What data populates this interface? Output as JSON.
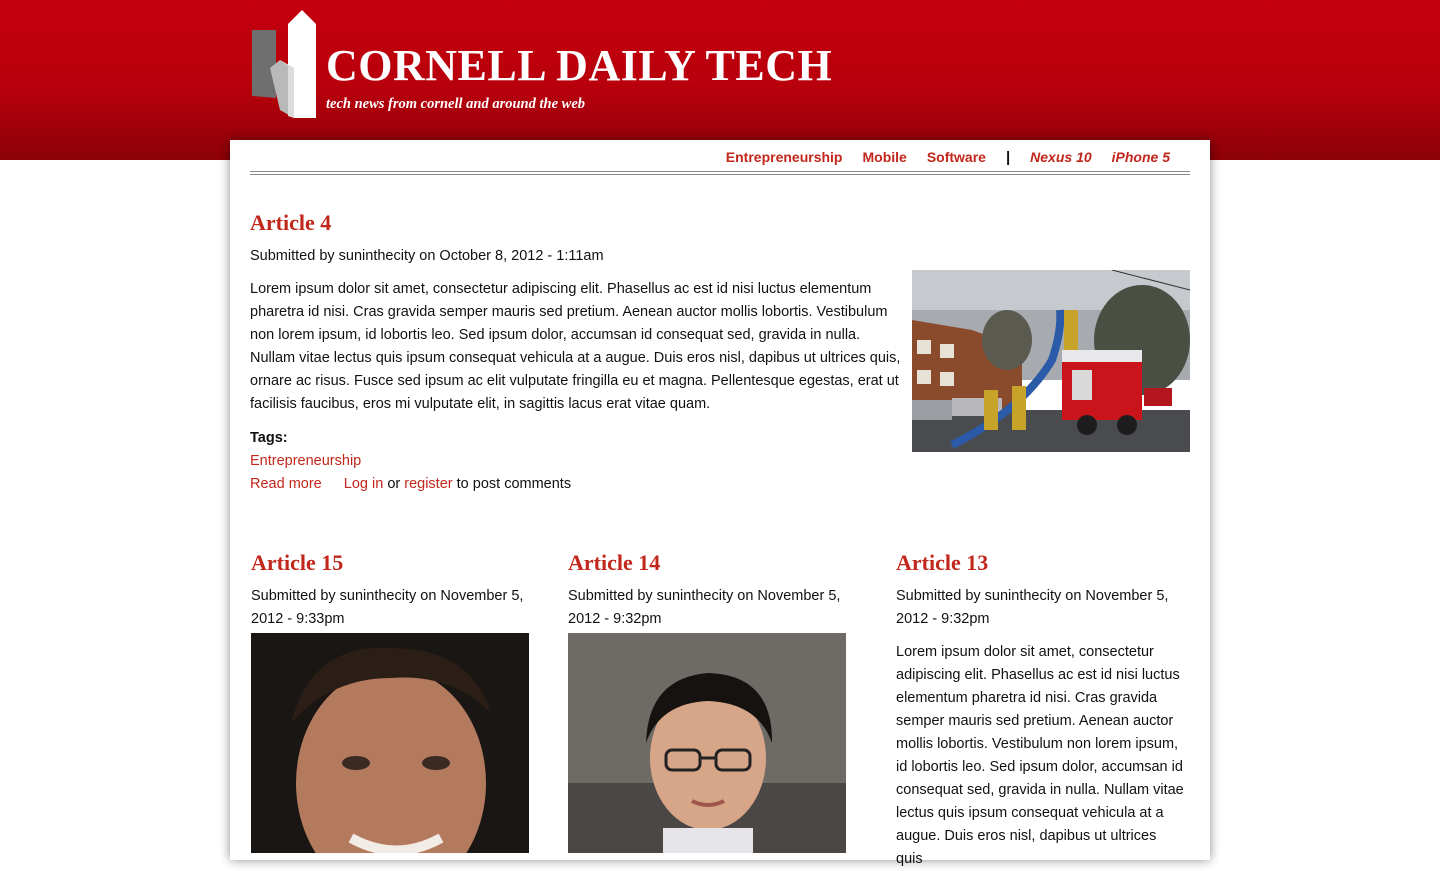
{
  "site": {
    "title": "CORNELL DAILY TECH",
    "slogan": "tech news from cornell and around the web"
  },
  "nav": {
    "primary": [
      "Entrepreneurship",
      "Mobile",
      "Software"
    ],
    "separator": "|",
    "featured": [
      "Nexus 10",
      "iPhone 5"
    ]
  },
  "featured_article": {
    "title": "Article 4",
    "meta": "Submitted by suninthecity on October 8, 2012 - 1:11am",
    "body": "Lorem ipsum dolor sit amet, consectetur adipiscing elit. Phasellus ac est id nisi luctus elementum pharetra id nisi. Cras gravida semper mauris sed pretium. Aenean auctor mollis lobortis. Vestibulum non lorem ipsum, id lobortis leo. Sed ipsum dolor, accumsan id consequat sed, gravida in nulla. Nullam vitae lectus quis ipsum consequat vehicula at a augue. Duis eros nisl, dapibus ut ultrices quis, ornare ac risus. Fusce sed ipsum ac elit vulputate fringilla eu et magna. Pellentesque egestas, erat ut facilisis faucibus, eros mi vulputate elit, in sagittis lacus erat vitae quam.",
    "tags_label": "Tags:",
    "tag": "Entrepreneurship",
    "read_more": "Read more",
    "log_in": "Log in",
    "or": "or",
    "register": "register",
    "post_comments": "to post comments"
  },
  "articles": [
    {
      "title": "Article 15",
      "meta": "Submitted by suninthecity on November 5, 2012 - 9:33pm"
    },
    {
      "title": "Article 14",
      "meta": "Submitted by suninthecity on November 5, 2012 - 9:32pm"
    },
    {
      "title": "Article 13",
      "meta": "Submitted by suninthecity on November 5, 2012 - 9:32pm",
      "body": "Lorem ipsum dolor sit amet, consectetur adipiscing elit. Phasellus ac est id nisi luctus elementum pharetra id nisi. Cras gravida semper mauris sed pretium. Aenean auctor mollis lobortis. Vestibulum non lorem ipsum, id lobortis leo. Sed ipsum dolor, accumsan id consequat sed, gravida in nulla. Nullam vitae lectus quis ipsum consequat vehicula at a augue. Duis eros nisl, dapibus ut ultrices quis"
    }
  ],
  "colors": {
    "brand_red": "#c4000d",
    "link_red": "#c1271b"
  }
}
